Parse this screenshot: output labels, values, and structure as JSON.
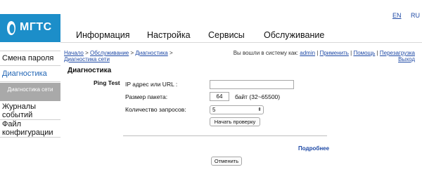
{
  "brand": {
    "logo_text": "МГТС",
    "accent": "#1c8ec9"
  },
  "lang": {
    "en": "EN",
    "ru": "RU"
  },
  "nav": [
    "Информация",
    "Настройка",
    "Сервисы",
    "Обслуживание"
  ],
  "sidebar": {
    "items": [
      "Смена пароля",
      "Диагностика"
    ],
    "sub_item": "Диагностика сети",
    "items_after": [
      "Журналы событий",
      "Файл конфигурации"
    ]
  },
  "breadcrumb": {
    "home": "Начало",
    "service": "Обслуживание",
    "diag": "Диагностика",
    "net": "Диагностика сети",
    "sep": " > "
  },
  "userbar": {
    "prefix": "Вы вошли в систему как:",
    "user": "admin",
    "apply": "Применить",
    "help": "Помощь",
    "reboot": "Перезагрузка",
    "logout": "Выход",
    "sep": " | "
  },
  "page_title": "Диагностика",
  "ping": {
    "section": "Ping Test",
    "ip_label": "IP адрес или URL :",
    "ip_value": "",
    "size_label": "Размер пакета:",
    "size_value": "64",
    "size_suffix": "байт (32~65500)",
    "count_label": "Количество запросов:",
    "count_value": "5",
    "start_button": "Начать проверку"
  },
  "more_link": "Подробнее",
  "cancel_button": "Отменить"
}
